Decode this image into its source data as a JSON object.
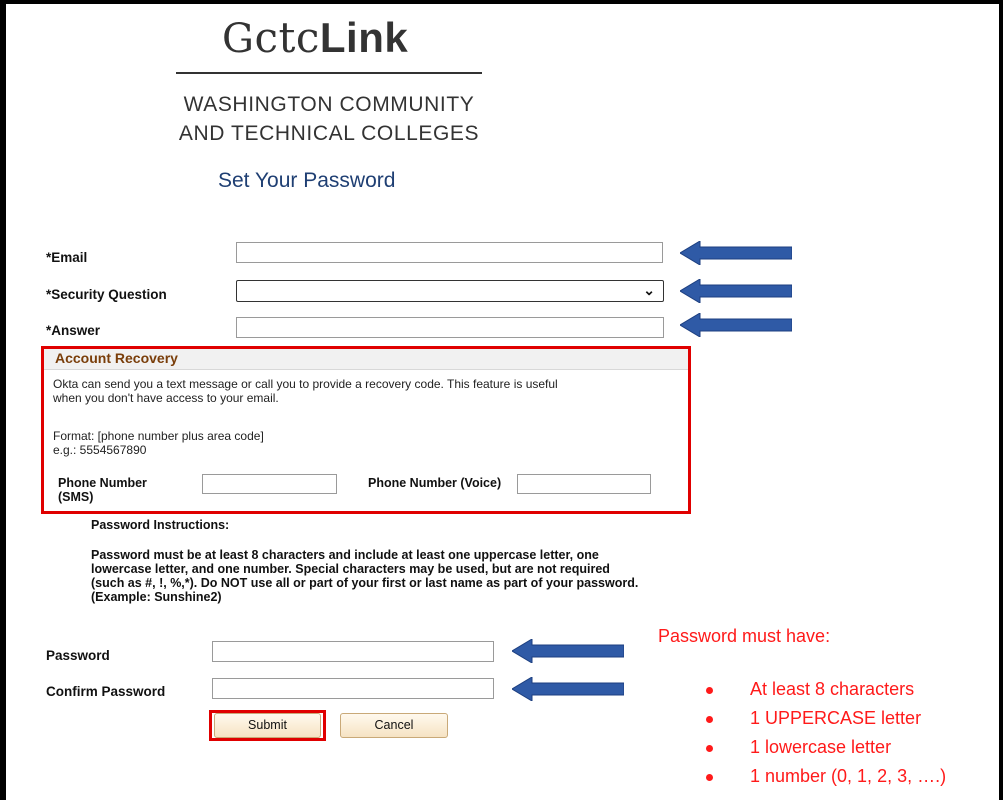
{
  "header": {
    "logo_mark": "G",
    "logo_ctc": "ctc",
    "logo_link": "Link",
    "org_line1": "WASHINGTON COMMUNITY",
    "org_line2": "AND TECHNICAL COLLEGES",
    "page_title": "Set Your Password"
  },
  "form": {
    "email_label": "*Email",
    "email_value": "",
    "security_question_label": "*Security Question",
    "security_question_value": "",
    "answer_label": "*Answer",
    "answer_value": ""
  },
  "account_recovery": {
    "title": "Account Recovery",
    "description_line1": "Okta can send you a text message or call you to provide a recovery code. This feature is useful",
    "description_line2": "when you don't have access to your email.",
    "format_line1": "Format: [phone number plus area code]",
    "format_line2": "e.g.: 5554567890",
    "sms_label_line1": "Phone Number",
    "sms_label_line2": "(SMS)",
    "sms_value": "",
    "voice_label": "Phone Number (Voice)",
    "voice_value": ""
  },
  "instructions": {
    "heading": "Password Instructions:",
    "line1": "Password must be at least 8 characters and include at least one uppercase letter, one",
    "line2": "lowercase letter, and one number. Special characters may be used, but are not required",
    "line3": "(such as #, !, %,*). Do NOT use all or part of your first or last name as part of your password.",
    "line4": "(Example: Sunshine2)"
  },
  "password": {
    "password_label": "Password",
    "password_value": "",
    "confirm_label": "Confirm Password",
    "confirm_value": ""
  },
  "buttons": {
    "submit_label": "Submit",
    "cancel_label": "Cancel"
  },
  "annotation": {
    "heading": "Password must have:",
    "rules": [
      "At least 8 characters",
      "1 UPPERCASE letter",
      "1 lowercase letter",
      "1 number (0, 1, 2, 3, ….)"
    ]
  },
  "colors": {
    "annotation_red": "#ff1a1a",
    "arrow_blue": "#2f5aa6",
    "title_blue": "#1f3f73",
    "recovery_title_brown": "#7a3e0a"
  }
}
